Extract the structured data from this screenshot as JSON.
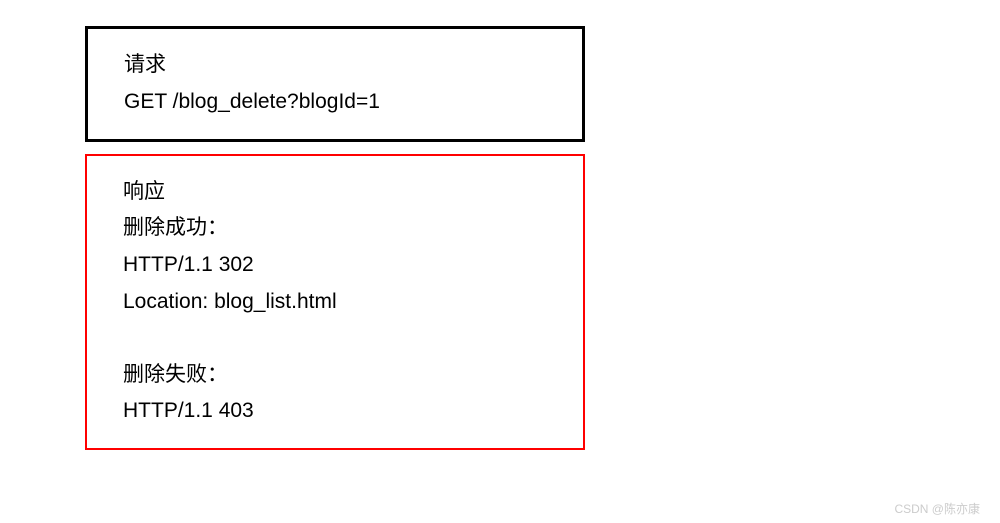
{
  "request": {
    "title": "请求",
    "line1": "GET /blog_delete?blogId=1"
  },
  "response": {
    "title": "响应",
    "success_label": "删除成功：",
    "success_status": "HTTP/1.1 302",
    "success_location": "Location: blog_list.html",
    "fail_label": "删除失败：",
    "fail_status": "HTTP/1.1 403"
  },
  "watermark": "CSDN @陈亦康"
}
